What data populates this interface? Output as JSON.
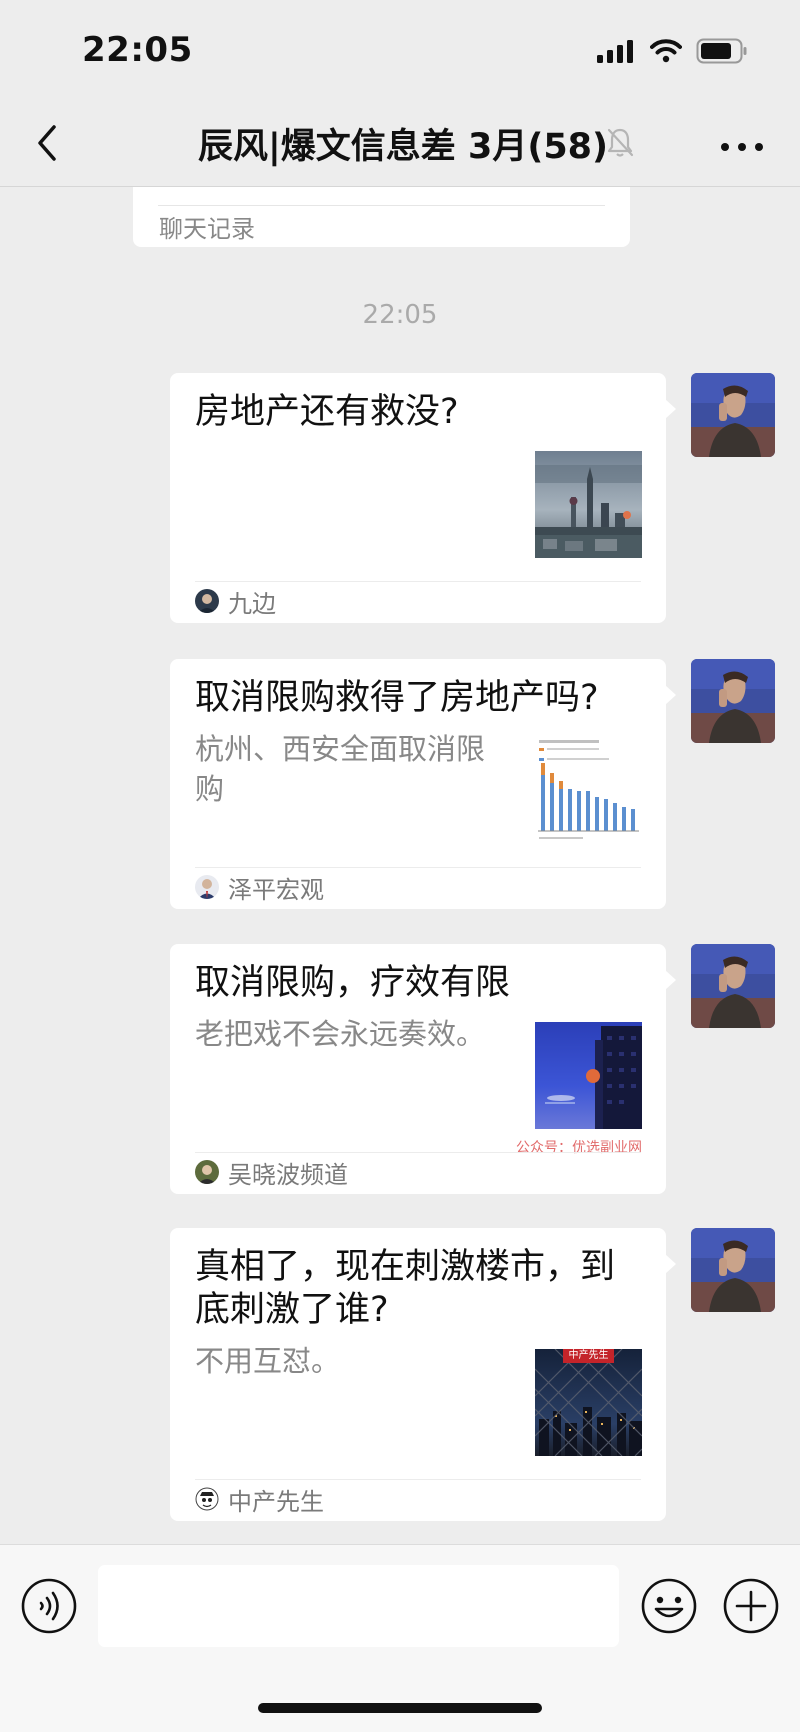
{
  "status_bar": {
    "time": "22:05",
    "icons": [
      "signal-icon",
      "wifi-icon",
      "battery-icon"
    ]
  },
  "nav": {
    "title": "辰风|爆文信息差 3月(58)",
    "back_icon": "chevron-left-icon",
    "mute_icon": "bell-off-icon",
    "more_icon": "more-dots-icon"
  },
  "chat": {
    "previous_card_label": "聊天记录",
    "timestamp": "22:05",
    "messages": [
      {
        "title": "房地产还有救没?",
        "description": "",
        "source": "九边",
        "thumbnail": "city-skyline-image"
      },
      {
        "title": "取消限购救得了房地产吗?",
        "description": "杭州、西安全面取消限购",
        "source": "泽平宏观",
        "thumbnail": "bar-chart-image"
      },
      {
        "title": "取消限购，疗效有限",
        "description": "老把戏不会永远奏效。",
        "source": "吴晓波频道",
        "thumbnail": "night-building-image",
        "watermark": "公众号：优选副业网"
      },
      {
        "title": "真相了，现在刺激楼市，到底刺激了谁?",
        "description": "不用互怼。",
        "source": "中产先生",
        "thumbnail": "city-fence-image",
        "thumbnail_label": "中产先生"
      }
    ]
  },
  "input_bar": {
    "placeholder": "",
    "voice_icon": "voice-icon",
    "emoji_icon": "emoji-icon",
    "add_icon": "add-icon"
  },
  "colors": {
    "background": "#ededed",
    "card": "#ffffff",
    "secondary_text": "#888888",
    "watermark": "#e26b6b"
  }
}
